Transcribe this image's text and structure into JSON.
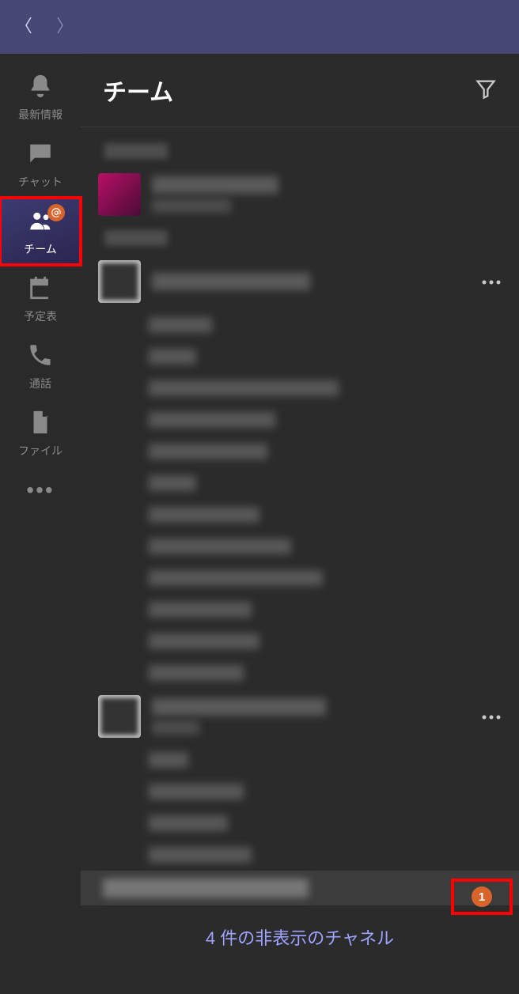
{
  "header": {
    "title": "チーム"
  },
  "rail": {
    "activity": "最新情報",
    "chat": "チャット",
    "teams": "チーム",
    "calendar": "予定表",
    "calls": "通話",
    "files": "ファイル"
  },
  "badge": {
    "count": "1"
  },
  "footer": {
    "hidden_channels": "4 件の非表示のチャネル"
  },
  "channels_a": [
    80,
    60,
    240,
    160,
    150,
    60,
    140,
    180,
    220,
    130,
    140,
    120
  ],
  "channels_b": [
    50,
    120,
    100,
    130
  ]
}
